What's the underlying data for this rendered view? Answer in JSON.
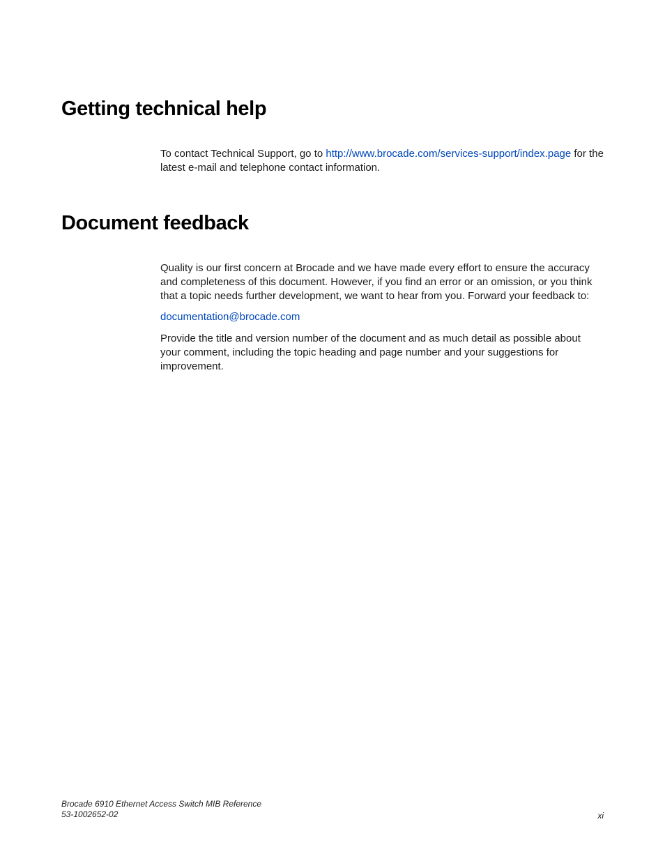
{
  "section1": {
    "heading": "Getting technical help",
    "p1_before": "To contact Technical Support, go to ",
    "p1_link": "http://www.brocade.com/services-support/index.page",
    "p1_after": " for the latest e-mail and telephone contact information."
  },
  "section2": {
    "heading": "Document feedback",
    "p1": "Quality is our first concern at Brocade and we have made every effort to ensure the accuracy and completeness of this document. However, if you find an error or an omission, or you think that a topic needs further development, we want to hear from you. Forward your feedback to:",
    "email": "documentation@brocade.com",
    "p2": "Provide the title and version number of the document and as much detail as possible about your comment, including the topic heading and page number and your suggestions for improvement."
  },
  "footer": {
    "title": "Brocade 6910 Ethernet Access Switch MIB Reference",
    "docnum": "53-1002652-02",
    "pagenum": "xi"
  }
}
